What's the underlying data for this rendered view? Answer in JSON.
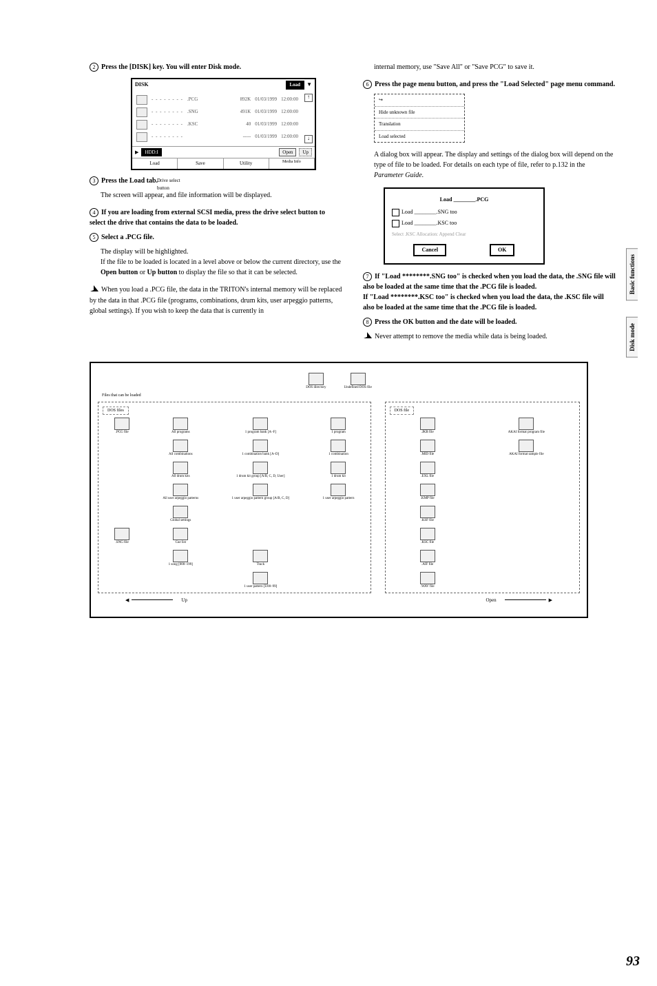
{
  "steps": {
    "s2": "Press the [DISK] key. You will enter Disk mode.",
    "s3": "Press the Load tab.",
    "s3_body": "The screen will appear, and file information will be displayed.",
    "s4": "If you are loading from external SCSI media, press the drive select button to select the drive that contains the data to be loaded.",
    "s5": "Select a .PCG file.",
    "s5_body_a": "The display will be highlighted.",
    "s5_body_b": "If the file to be loaded is located in a level above or below the current directory, use the ",
    "s5_body_b_bold1": "Open button",
    "s5_body_b_mid": " or ",
    "s5_body_b_bold2": "Up button",
    "s5_body_b_end": " to display the file so that it can be selected.",
    "note1": "When you load a .PCG file, the data in the TRITON's internal memory will be replaced by the data in that .PCG file (programs, combinations, drum kits, user arpeggio patterns, global settings). If you wish to keep the data that is currently in ",
    "note1_cont": "internal memory, use \"Save All\" or \"Save PCG\" to save it.",
    "s6": "Press the page menu button, and press the \"Load Selected\" page menu command.",
    "s6_body": "A dialog box will appear. The display and settings of the dialog box will depend on the type of file to be loaded. For details on each type of file, refer to p.132 in the ",
    "s6_body_ital": "Parameter Guide.",
    "s7a": "If \"Load ********.SNG too\" is checked when you load the data, the .SNG file will also be loaded at the same time that the .PCG file is loaded.",
    "s7b": "If \"Load ********.KSC too\" is checked when you load the data, the .KSC file will also be loaded at the same time that the .PCG file is loaded.",
    "s8": "Press the OK button and the date will be loaded.",
    "note2": "Never attempt to remove the media while data is being loaded."
  },
  "screen": {
    "title": "DISK",
    "load": "Load",
    "drive_select_label_a": "Drive select",
    "drive_select_label_b": "button",
    "rows": [
      {
        "ext": ".PCG",
        "size": "892K",
        "date": "01/03/1999",
        "time": "12:00:00"
      },
      {
        "ext": ".SNG",
        "size": "491K",
        "date": "01/03/1999",
        "time": "12:00:00"
      },
      {
        "ext": ".KSC",
        "size": "40",
        "date": "01/03/1999",
        "time": "12:00:00"
      },
      {
        "ext": "",
        "size": "-----",
        "date": "01/03/1999",
        "time": "12:00:00"
      }
    ],
    "drive": "HDD:I",
    "open": "Open",
    "up": "Up",
    "tabs": [
      "Load",
      "Save",
      "Utility",
      "Media Info"
    ]
  },
  "menu": {
    "i1": "Hide unknown file",
    "i2": "Translation",
    "i3": "Load selected"
  },
  "dialog": {
    "title_a": "Load",
    "title_b": ".PCG",
    "cb1a": "Load",
    "cb1b": ".SNG too",
    "cb2a": "Load",
    "cb2b": ".KSC too",
    "radio": "Select .KSC Allocation:    Append      Clear",
    "cancel": "Cancel",
    "ok": "OK"
  },
  "sidetabs": {
    "t1": "Basic functions",
    "t2": "Disk mode"
  },
  "tree": {
    "top1": "DOS directory",
    "top2": "Undefined DOS file",
    "left_hdr": "Files that can be loaded",
    "dos_files": "DOS files",
    "dos_file": "DOS file",
    "pcg": ".PCG file",
    "allprog": "All programs",
    "progbank": "1 program bank [A–F]",
    "prog1": "1 program",
    "allcomb": "All combinations",
    "combbank": "1 combination bank [A–D]",
    "comb1": "1 combination",
    "alldk": "All drum kits",
    "dkgrp": "1 drum kit group [A/B, C, D, User]",
    "dk1": "1 drum kit",
    "allarp": "All user arpeggio patterns",
    "arpgrp": "1 user arpeggio pattern group [A/B, C, D]",
    "arp1": "1 user arpeggio pattern",
    "global": "Global settings",
    "sng": ".SNG file",
    "cue": "Cue list",
    "song1": "1 song [000–199]",
    "track": "Track",
    "upat": "1 user pattern [U00–99]",
    "jkb": ".JKB file",
    "akaiprog": "AKAI format program file",
    "mid": ".MID file",
    "akaisamp": "AKAI format sample file",
    "exl": ".EXL file",
    "kmp": ".KMP file",
    "ksf": ".KSF file",
    "ksc": ".KSC file",
    "aif": ".AIF file",
    "wav": ".WAV file",
    "up": "Up",
    "open": "Open"
  },
  "page_num": "93"
}
